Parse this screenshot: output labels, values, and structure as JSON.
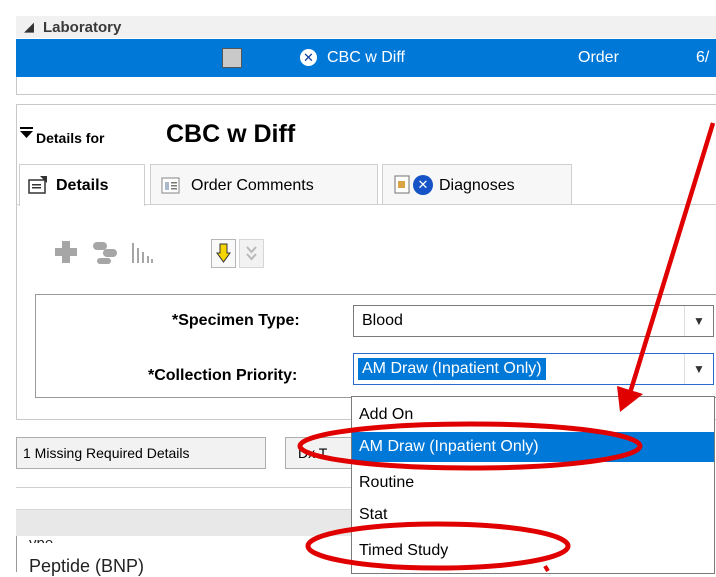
{
  "laboratory": {
    "section_title": "Laboratory",
    "order": {
      "name": "CBC w Diff",
      "type": "Order",
      "date": "6/"
    }
  },
  "details": {
    "prefix": "Details for",
    "order_name": "CBC w Diff",
    "tabs": [
      {
        "label": "Details",
        "active": true
      },
      {
        "label": "Order Comments",
        "active": false
      },
      {
        "label": "Diagnoses",
        "active": false
      }
    ]
  },
  "form": {
    "specimen_type": {
      "label": "*Specimen Type:",
      "value": "Blood"
    },
    "collection_priority": {
      "label": "*Collection Priority:",
      "value": "AM Draw (Inpatient Only)"
    }
  },
  "dropdown": {
    "options": [
      "Add On",
      "AM Draw (Inpatient Only)",
      "Routine",
      "Stat",
      "Timed Study"
    ],
    "selected": "AM Draw (Inpatient Only)"
  },
  "footer": {
    "missing_label": "1 Missing Required Details",
    "dx_partial": "Dx T",
    "partial_text_top": "ype",
    "partial_text_bottom": "Peptide (BNP)"
  },
  "colors": {
    "selection_blue": "#0078d7",
    "annotation_red": "#e00000"
  }
}
